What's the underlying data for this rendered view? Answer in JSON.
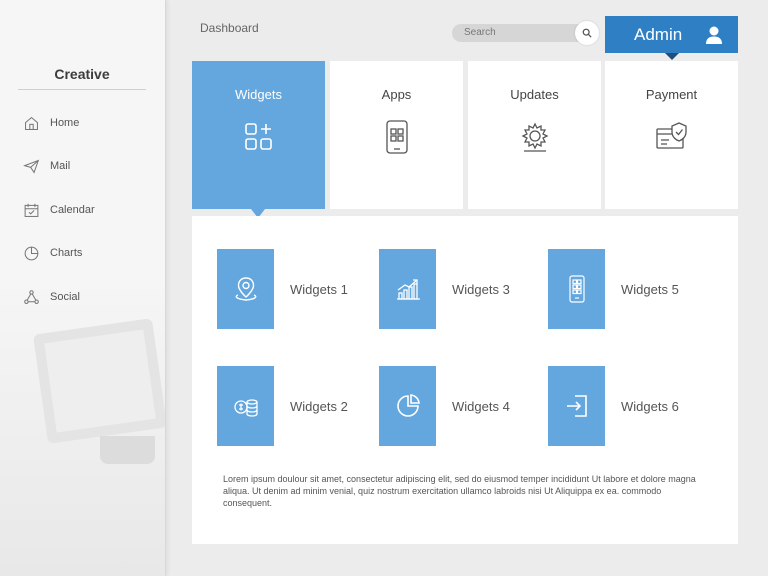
{
  "sidebar": {
    "brand": "Creative",
    "items": [
      {
        "label": "Home",
        "icon": "home-icon"
      },
      {
        "label": "Mail",
        "icon": "send-icon"
      },
      {
        "label": "Calendar",
        "icon": "calendar-icon"
      },
      {
        "label": "Charts",
        "icon": "pie-chart-icon"
      },
      {
        "label": "Social",
        "icon": "network-icon"
      }
    ]
  },
  "header": {
    "title": "Dashboard",
    "search_placeholder": "Search",
    "user_label": "Admin"
  },
  "cards": [
    {
      "label": "Widgets",
      "icon": "widgets-icon",
      "active": true
    },
    {
      "label": "Apps",
      "icon": "phone-apps-icon"
    },
    {
      "label": "Updates",
      "icon": "gear-icon"
    },
    {
      "label": "Payment",
      "icon": "card-shield-icon"
    }
  ],
  "widgets": [
    {
      "label": "Widgets 1",
      "icon": "map-pin-icon"
    },
    {
      "label": "Widgets 2",
      "icon": "coins-icon"
    },
    {
      "label": "Widgets 3",
      "icon": "growth-chart-icon"
    },
    {
      "label": "Widgets 4",
      "icon": "pie-chart-icon"
    },
    {
      "label": "Widgets 5",
      "icon": "mobile-grid-icon"
    },
    {
      "label": "Widgets 6",
      "icon": "sign-in-icon"
    }
  ],
  "description": "Lorem ipsum doulour sit amet, consectetur adipiscing elit, sed do eiusmod temper incididunt Ut labore et dolore magna aliqua. Ut denim ad minim venial, quiz nostrum exercitation ullamco labroids nisi Ut Aliquippa ex ea. commodo consequent.",
  "colors": {
    "accent": "#64a7df",
    "admin": "#2f7fc4"
  }
}
